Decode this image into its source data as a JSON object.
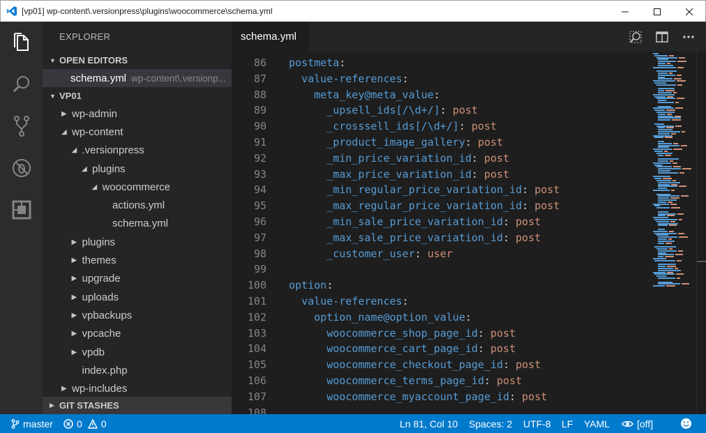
{
  "window": {
    "title": "[vp01] wp-content\\.versionpress\\plugins\\woocommerce\\schema.yml",
    "controls": [
      "minimize",
      "maximize",
      "close"
    ]
  },
  "activity_bar": {
    "items": [
      {
        "name": "explorer",
        "icon": "files-icon",
        "active": true
      },
      {
        "name": "search",
        "icon": "search-icon",
        "active": false
      },
      {
        "name": "source-control",
        "icon": "git-branch-icon",
        "active": false
      },
      {
        "name": "debug",
        "icon": "no-bug-icon",
        "active": false
      },
      {
        "name": "extensions",
        "icon": "extensions-icon",
        "active": false
      }
    ]
  },
  "sidebar": {
    "header": "EXPLORER",
    "open_editors": {
      "label": "OPEN EDITORS",
      "items": [
        {
          "name": "schema.yml",
          "path": "wp-content\\.versionp..."
        }
      ]
    },
    "project": {
      "label": "VP01",
      "tree": [
        {
          "label": "wp-admin",
          "depth": 0,
          "twisty": "collapsed"
        },
        {
          "label": "wp-content",
          "depth": 0,
          "twisty": "expanded"
        },
        {
          "label": ".versionpress",
          "depth": 1,
          "twisty": "expanded"
        },
        {
          "label": "plugins",
          "depth": 2,
          "twisty": "expanded"
        },
        {
          "label": "woocommerce",
          "depth": 3,
          "twisty": "expanded"
        },
        {
          "label": "actions.yml",
          "depth": 4,
          "twisty": "none"
        },
        {
          "label": "schema.yml",
          "depth": 4,
          "twisty": "none"
        },
        {
          "label": "plugins",
          "depth": 1,
          "twisty": "collapsed"
        },
        {
          "label": "themes",
          "depth": 1,
          "twisty": "collapsed"
        },
        {
          "label": "upgrade",
          "depth": 1,
          "twisty": "collapsed"
        },
        {
          "label": "uploads",
          "depth": 1,
          "twisty": "collapsed"
        },
        {
          "label": "vpbackups",
          "depth": 1,
          "twisty": "collapsed"
        },
        {
          "label": "vpcache",
          "depth": 1,
          "twisty": "collapsed"
        },
        {
          "label": "vpdb",
          "depth": 1,
          "twisty": "collapsed"
        },
        {
          "label": "index.php",
          "depth": 1,
          "twisty": "none"
        },
        {
          "label": "wp-includes",
          "depth": 0,
          "twisty": "collapsed"
        }
      ]
    },
    "git_stashes": "GIT STASHES"
  },
  "editor": {
    "tab": {
      "label": "schema.yml"
    },
    "actions": [
      "open-preview-icon",
      "split-editor-icon",
      "more-icon"
    ],
    "lines": [
      {
        "num": "86",
        "indent": "",
        "key": "postmeta",
        "value": ""
      },
      {
        "num": "87",
        "indent": "  ",
        "key": "value-references",
        "value": ""
      },
      {
        "num": "88",
        "indent": "    ",
        "key": "meta_key@meta_value",
        "value": ""
      },
      {
        "num": "89",
        "indent": "      ",
        "key": "_upsell_ids[/\\d+/]",
        "value": "post"
      },
      {
        "num": "90",
        "indent": "      ",
        "key": "_crosssell_ids[/\\d+/]",
        "value": "post"
      },
      {
        "num": "91",
        "indent": "      ",
        "key": "_product_image_gallery",
        "value": "post"
      },
      {
        "num": "92",
        "indent": "      ",
        "key": "_min_price_variation_id",
        "value": "post"
      },
      {
        "num": "93",
        "indent": "      ",
        "key": "_max_price_variation_id",
        "value": "post"
      },
      {
        "num": "94",
        "indent": "      ",
        "key": "_min_regular_price_variation_id",
        "value": "post"
      },
      {
        "num": "95",
        "indent": "      ",
        "key": "_max_regular_price_variation_id",
        "value": "post"
      },
      {
        "num": "96",
        "indent": "      ",
        "key": "_min_sale_price_variation_id",
        "value": "post"
      },
      {
        "num": "97",
        "indent": "      ",
        "key": "_max_sale_price_variation_id",
        "value": "post"
      },
      {
        "num": "98",
        "indent": "      ",
        "key": "_customer_user",
        "value": "user"
      },
      {
        "num": "99",
        "indent": "",
        "key": "",
        "value": ""
      },
      {
        "num": "100",
        "indent": "",
        "key": "option",
        "value": ""
      },
      {
        "num": "101",
        "indent": "  ",
        "key": "value-references",
        "value": ""
      },
      {
        "num": "102",
        "indent": "    ",
        "key": "option_name@option_value",
        "value": ""
      },
      {
        "num": "103",
        "indent": "      ",
        "key": "woocommerce_shop_page_id",
        "value": "post"
      },
      {
        "num": "104",
        "indent": "      ",
        "key": "woocommerce_cart_page_id",
        "value": "post"
      },
      {
        "num": "105",
        "indent": "      ",
        "key": "woocommerce_checkout_page_id",
        "value": "post"
      },
      {
        "num": "106",
        "indent": "      ",
        "key": "woocommerce_terms_page_id",
        "value": "post"
      },
      {
        "num": "107",
        "indent": "      ",
        "key": "woocommerce_myaccount_page_id",
        "value": "post"
      },
      {
        "num": "108",
        "indent": "",
        "key": "",
        "value": ""
      }
    ]
  },
  "status_bar": {
    "branch": "master",
    "errors": "0",
    "warnings": "0",
    "position": "Ln 81, Col 10",
    "indentation": "Spaces: 2",
    "encoding": "UTF-8",
    "eol": "LF",
    "language": "YAML",
    "preview": "[off]"
  },
  "colors": {
    "accent": "#007acc",
    "key": "#569cd6",
    "value": "#ce9178",
    "punctuation": "#d4d4d4",
    "line_number": "#858585"
  }
}
